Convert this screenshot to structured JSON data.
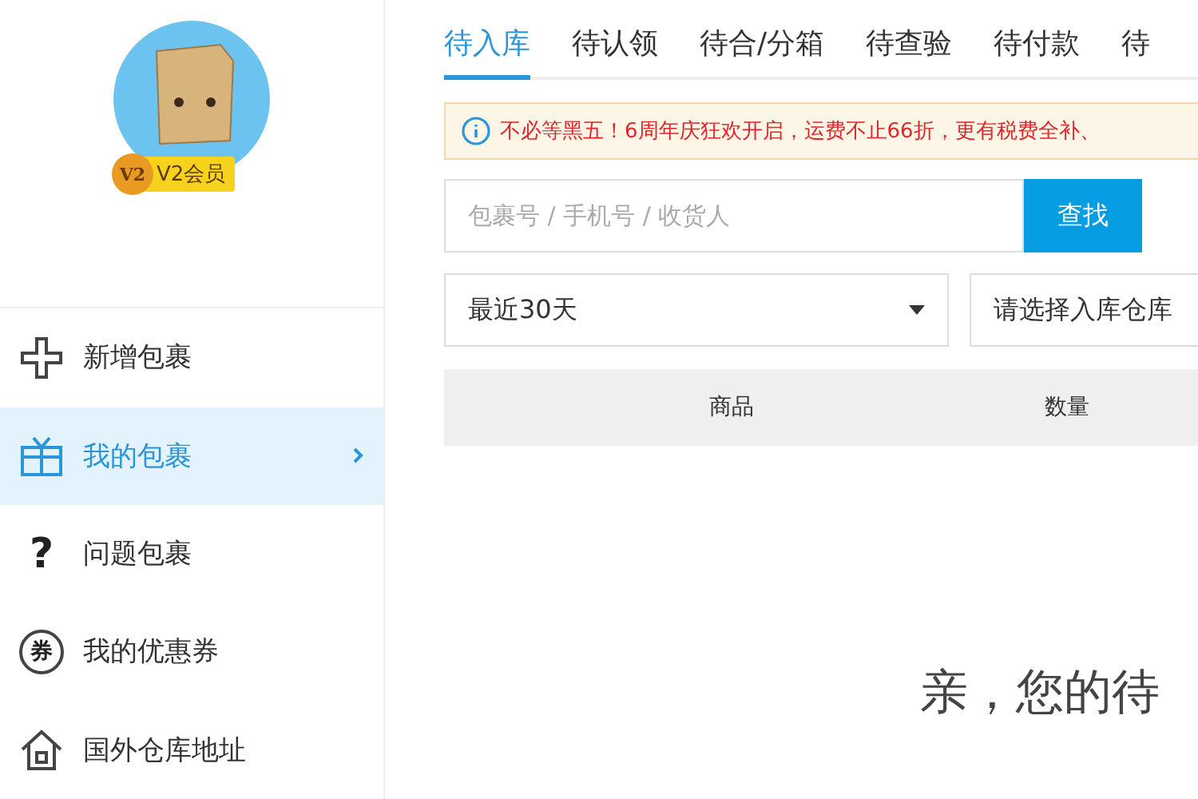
{
  "profile": {
    "level_badge": "V2",
    "level_label": "V2会员"
  },
  "sidebar": {
    "items": [
      {
        "label": "新增包裹",
        "kind": "plus",
        "selected": false
      },
      {
        "label": "我的包裹",
        "kind": "gift",
        "selected": true
      },
      {
        "label": "问题包裹",
        "kind": "question",
        "icon_text": "?",
        "selected": false
      },
      {
        "label": "我的优惠券",
        "kind": "coupon",
        "icon_text": "券",
        "selected": false
      },
      {
        "label": "国外仓库地址",
        "kind": "home",
        "selected": false
      }
    ]
  },
  "tabs": [
    {
      "label": "待入库",
      "selected": true
    },
    {
      "label": "待认领",
      "selected": false
    },
    {
      "label": "待合/分箱",
      "selected": false
    },
    {
      "label": "待查验",
      "selected": false
    },
    {
      "label": "待付款",
      "selected": false
    },
    {
      "label": "待",
      "selected": false
    }
  ],
  "notice": "不必等黑五！6周年庆狂欢开启，运费不止66折，更有税费全补、",
  "search": {
    "placeholder": "包裹号 / 手机号 / 收货人",
    "button": "查找"
  },
  "filters": [
    {
      "value": "最近30天",
      "kind": "dropdown"
    },
    {
      "value": "请选择入库仓库",
      "kind": "plain"
    }
  ],
  "table": {
    "columns": [
      "商品",
      "数量"
    ]
  },
  "empty_message": "亲，您的待"
}
